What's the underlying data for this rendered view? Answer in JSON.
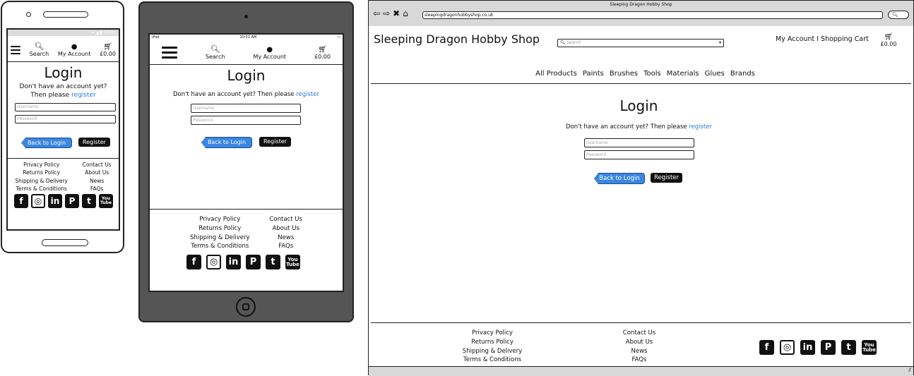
{
  "phone": {
    "status_time": "10:01",
    "nav": {
      "search": "Search",
      "account": "My Account",
      "cart_total": "£0.00"
    },
    "login": {
      "title": "Login",
      "prompt_line1": "Don't have an account yet?",
      "prompt_line2": "Then please",
      "register_link": "register",
      "username_placeholder": "Username",
      "password_placeholder": "Password",
      "back_button": "Back to Login",
      "register_button": "Register"
    },
    "footer": {
      "col1": [
        "Privacy Policy",
        "Returns Policy",
        "Shipping & Delivery",
        "Terms & Conditions"
      ],
      "col2": [
        "Contact Us",
        "About Us",
        "News",
        "FAQs"
      ]
    }
  },
  "tablet": {
    "status_left": "iPod",
    "status_time": "10:01 AM",
    "nav": {
      "search": "Search",
      "account": "My Account",
      "cart_total": "£0.00"
    },
    "login": {
      "title": "Login",
      "prompt": "Don't have an account yet? Then please",
      "register_link": "register",
      "username_placeholder": "Username",
      "password_placeholder": "Password",
      "back_button": "Back to Login",
      "register_button": "Register"
    },
    "footer": {
      "col1": [
        "Privacy Policy",
        "Returns Policy",
        "Shipping & Delivery",
        "Terms & Conditions"
      ],
      "col2": [
        "Contact Us",
        "About Us",
        "News",
        "FAQs"
      ]
    }
  },
  "browser": {
    "window_title": "Sleeping Dragon Hobby Shop",
    "url": "sleepingdragonhobbyshop.co.uk",
    "site_title": "Sleeping Dragon Hobby Shop",
    "search_placeholder": "search",
    "account_links": "My Account I Shopping Cart",
    "cart_total": "£0.00",
    "categories": [
      "All Products",
      "Paints",
      "Brushes",
      "Tools",
      "Materials",
      "Glues",
      "Brands"
    ],
    "login": {
      "title": "Login",
      "prompt": "Don't have an account yet? Then please",
      "register_link": "register",
      "username_placeholder": "Username",
      "password_placeholder": "Password",
      "back_button": "Back to Login",
      "register_button": "Register"
    },
    "footer": {
      "col1": [
        "Privacy Policy",
        "Returns Policy",
        "Shipping & Delivery",
        "Terms & Conditions"
      ],
      "col2": [
        "Contact Us",
        "About Us",
        "News",
        "FAQs"
      ]
    }
  },
  "social_icons": [
    {
      "name": "facebook-icon",
      "glyph": "f"
    },
    {
      "name": "instagram-icon",
      "glyph": "◎"
    },
    {
      "name": "linkedin-icon",
      "glyph": "in"
    },
    {
      "name": "pinterest-icon",
      "glyph": "P"
    },
    {
      "name": "twitter-icon",
      "glyph": "t"
    },
    {
      "name": "youtube-icon",
      "glyph": "You\nTube"
    }
  ],
  "colors": {
    "accent": "#2a7ad6",
    "button_blue": "#3a86e0",
    "button_dark": "#111111",
    "device_gray": "#555555"
  }
}
